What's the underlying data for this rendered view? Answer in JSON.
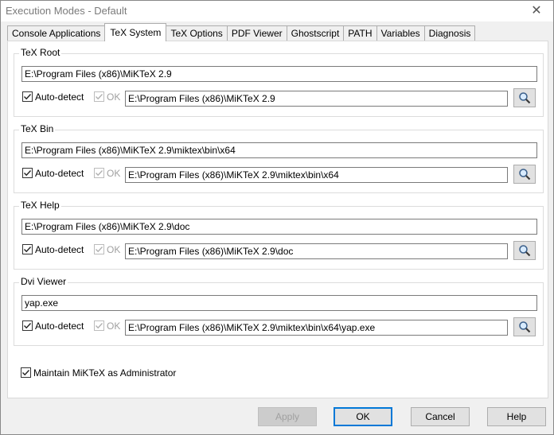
{
  "window": {
    "title": "Execution Modes - Default",
    "close_glyph": "✕"
  },
  "tabs": [
    {
      "label": "Console Applications",
      "active": false
    },
    {
      "label": "TeX System",
      "active": true
    },
    {
      "label": "TeX Options",
      "active": false
    },
    {
      "label": "PDF Viewer",
      "active": false
    },
    {
      "label": "Ghostscript",
      "active": false
    },
    {
      "label": "PATH",
      "active": false
    },
    {
      "label": "Variables",
      "active": false
    },
    {
      "label": "Diagnosis",
      "active": false
    }
  ],
  "groups": {
    "tex_root": {
      "legend": "TeX Root",
      "value": "E:\\Program Files (x86)\\MiKTeX 2.9",
      "auto_detect": "Auto-detect",
      "ok": "OK",
      "detected": "E:\\Program Files (x86)\\MiKTeX 2.9"
    },
    "tex_bin": {
      "legend": "TeX Bin",
      "value": "E:\\Program Files (x86)\\MiKTeX 2.9\\miktex\\bin\\x64",
      "auto_detect": "Auto-detect",
      "ok": "OK",
      "detected": "E:\\Program Files (x86)\\MiKTeX 2.9\\miktex\\bin\\x64"
    },
    "tex_help": {
      "legend": "TeX Help",
      "value": "E:\\Program Files (x86)\\MiKTeX 2.9\\doc",
      "auto_detect": "Auto-detect",
      "ok": "OK",
      "detected": "E:\\Program Files (x86)\\MiKTeX 2.9\\doc"
    },
    "dvi_viewer": {
      "legend": "Dvi Viewer",
      "value": "yap.exe",
      "auto_detect": "Auto-detect",
      "ok": "OK",
      "detected": "E:\\Program Files (x86)\\MiKTeX 2.9\\miktex\\bin\\x64\\yap.exe"
    }
  },
  "maintain_admin": {
    "label": "Maintain MiKTeX as Administrator",
    "checked": true
  },
  "buttons": {
    "apply": "Apply",
    "ok": "OK",
    "cancel": "Cancel",
    "help": "Help"
  },
  "colors": {
    "accent": "#0078d7",
    "disabled_text": "#a0a0a0"
  },
  "icons": {
    "browse": "magnifier-icon",
    "close": "close-icon",
    "check": "checkmark-icon"
  }
}
